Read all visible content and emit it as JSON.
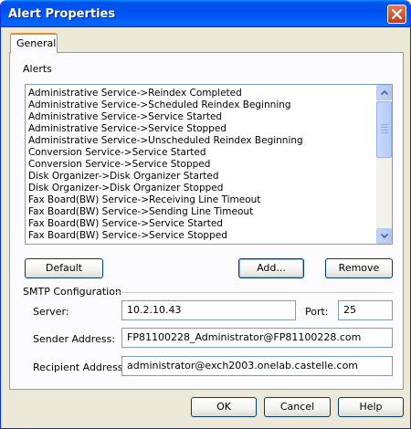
{
  "window": {
    "title": "Alert Properties"
  },
  "tabs": [
    {
      "label": "General"
    }
  ],
  "alerts": {
    "label": "Alerts",
    "items": [
      "Administrative Service->Reindex Completed",
      "Administrative Service->Scheduled Reindex Beginning",
      "Administrative Service->Service Started",
      "Administrative Service->Service Stopped",
      "Administrative Service->Unscheduled Reindex Beginning",
      "Conversion Service->Service Started",
      "Conversion Service->Service Stopped",
      "Disk Organizer->Disk Organizer Started",
      "Disk Organizer->Disk Organizer Stopped",
      "Fax Board(BW) Service->Receiving Line Timeout",
      "Fax Board(BW) Service->Sending Line Timeout",
      "Fax Board(BW) Service->Service Started",
      "Fax Board(BW) Service->Service Stopped"
    ],
    "buttons": {
      "default": "Default",
      "add": "Add...",
      "remove": "Remove"
    }
  },
  "smtp": {
    "section_label": "SMTP Configuration",
    "server_label": "Server:",
    "server_value": "10.2.10.43",
    "port_label": "Port:",
    "port_value": "25",
    "sender_label": "Sender Address:",
    "sender_value": "FP81100228_Administrator@FP81100228.com",
    "recipient_label": "Recipient Address:",
    "recipient_value": "administrator@exch2003.onelab.castelle.com"
  },
  "footer": {
    "ok": "OK",
    "cancel": "Cancel",
    "help": "Help"
  }
}
